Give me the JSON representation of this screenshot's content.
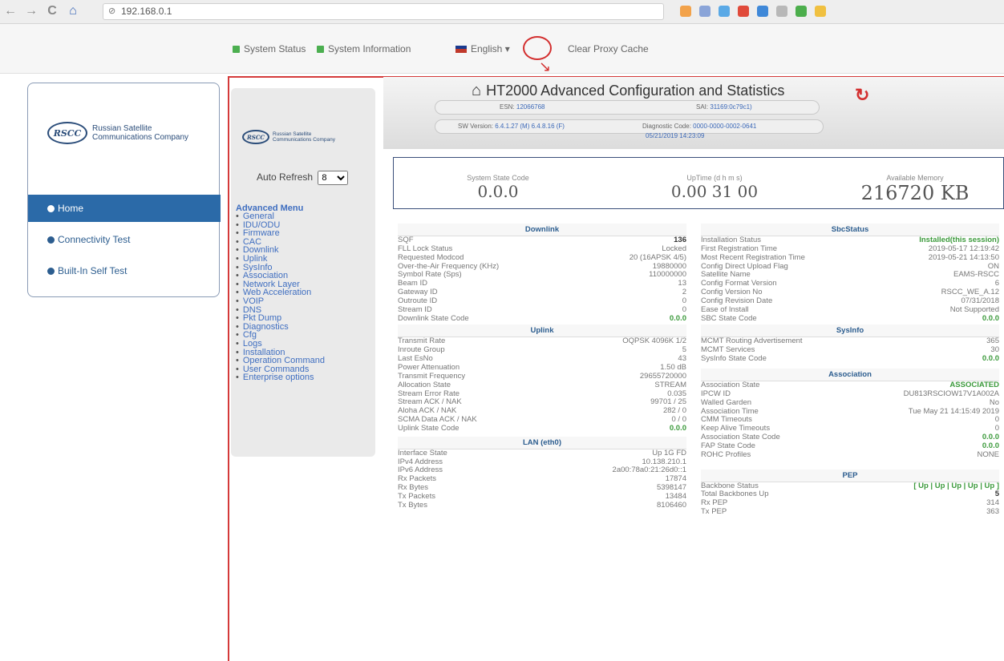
{
  "browser": {
    "url": "192.168.0.1",
    "back": "←",
    "forward": "→",
    "reload": "C",
    "home": "⌂",
    "secure": "⊘"
  },
  "topnav": {
    "system_status": "System Status",
    "system_information": "System Information",
    "language": "English ▾",
    "clear_proxy": "Clear Proxy Cache"
  },
  "logo": {
    "mark": "RSCC",
    "line1": "Russian Satellite",
    "line2": "Communications Company"
  },
  "leftnav": [
    {
      "label": "Home",
      "active": true
    },
    {
      "label": "Connectivity Test",
      "active": false
    },
    {
      "label": "Built-In Self Test",
      "active": false
    }
  ],
  "adv": {
    "auto_refresh_label": "Auto Refresh",
    "auto_refresh_value": "8",
    "menu_title": "Advanced Menu",
    "items": [
      "General",
      "IDU/ODU",
      "Firmware",
      "CAC",
      "Downlink",
      "Uplink",
      "SysInfo",
      "Association",
      "Network Layer",
      "Web Acceleration",
      "VOIP",
      "DNS",
      "Pkt Dump",
      "Diagnostics",
      "Cfg",
      "Logs",
      "Installation",
      "Operation Command",
      "User Commands",
      "Enterprise options"
    ]
  },
  "header": {
    "home_icon": "⌂",
    "title": "HT2000 Advanced Configuration and Statistics",
    "refresh_icon": "↻",
    "esn_label": "ESN:",
    "esn_value": "12066768",
    "san_label": "SAI:",
    "san_value": "31169:0c79c1)",
    "sw_label": "SW Version:",
    "sw_value": "6.4.1.27 (M) 6.4.8.16 (F)",
    "diag_label": "Diagnostic Code:",
    "diag_value": "0000-0000-0002-0641",
    "datetime": "05/21/2019 14:23:09"
  },
  "stats": {
    "state_label": "System State Code",
    "state_value": "0.0.0",
    "uptime_label": "UpTime (d h m s)",
    "uptime_value": "0.00 31 00",
    "memory_label": "Available Memory",
    "memory_value": "216720 KB"
  },
  "left_tables": [
    {
      "title": "Downlink",
      "rows": [
        [
          "SQF",
          "136",
          "b"
        ],
        [
          "FLL Lock Status",
          "Locked",
          ""
        ],
        [
          "Requested Modcod",
          "20 (16APSK 4/5)",
          ""
        ],
        [
          "Over-the-Air Frequency (KHz)",
          "19880000",
          ""
        ],
        [
          "Symbol Rate (Sps)",
          "110000000",
          ""
        ],
        [
          "Beam ID",
          "13",
          ""
        ],
        [
          "Gateway ID",
          "2",
          ""
        ],
        [
          "Outroute ID",
          "0",
          ""
        ],
        [
          "Stream ID",
          "0",
          ""
        ],
        [
          "Downlink State Code",
          "0.0.0",
          "g"
        ]
      ]
    },
    {
      "title": "Uplink",
      "rows": [
        [
          "Transmit Rate",
          "OQPSK 4096K 1/2",
          ""
        ],
        [
          "Inroute Group",
          "5",
          ""
        ],
        [
          "Last EsNo",
          "43",
          ""
        ],
        [
          "Power Attenuation",
          "1.50 dB",
          ""
        ],
        [
          "Transmit Frequency",
          "29655720000",
          ""
        ],
        [
          "Allocation State",
          "STREAM",
          ""
        ],
        [
          "Stream Error Rate",
          "0.035",
          ""
        ],
        [
          "Stream ACK / NAK",
          "99701 / 25",
          ""
        ],
        [
          "Aloha ACK / NAK",
          "282 / 0",
          ""
        ],
        [
          "SCMA Data ACK / NAK",
          "0 / 0",
          ""
        ],
        [
          "Uplink State Code",
          "0.0.0",
          "g"
        ]
      ]
    },
    {
      "title": "LAN (eth0)",
      "rows": [
        [
          "Interface State",
          "Up 1G FD",
          ""
        ],
        [
          "IPv4 Address",
          "10.138.210.1",
          ""
        ],
        [
          "IPv6 Address",
          "2a00:78a0:21:26d0::1",
          ""
        ],
        [
          "Rx Packets",
          "17874",
          ""
        ],
        [
          "Rx Bytes",
          "5398147",
          ""
        ],
        [
          "Tx Packets",
          "13484",
          ""
        ],
        [
          "Tx Bytes",
          "8106460",
          ""
        ]
      ]
    }
  ],
  "right_tables": [
    {
      "title": "SbcStatus",
      "rows": [
        [
          "Installation Status",
          "Installed(this session)",
          "gs"
        ],
        [
          "First Registration Time",
          "2019-05-17 12:19:42",
          ""
        ],
        [
          "Most Recent Registration Time",
          "2019-05-21 14:13:50",
          ""
        ],
        [
          "Config Direct Upload Flag",
          "ON",
          ""
        ],
        [
          "Satellite Name",
          "EAMS-RSCC",
          ""
        ],
        [
          "Config Format Version",
          "6",
          ""
        ],
        [
          "Config Version No",
          "RSCC_WE_A.12",
          ""
        ],
        [
          "Config Revision Date",
          "07/31/2018",
          ""
        ],
        [
          "Ease of Install",
          "Not Supported",
          ""
        ],
        [
          "SBC State Code",
          "0.0.0",
          "g"
        ]
      ]
    },
    {
      "title": "SysInfo",
      "rows": [
        [
          "MCMT Routing Advertisement",
          "365",
          ""
        ],
        [
          "MCMT Services",
          "30",
          ""
        ],
        [
          "SysInfo State Code",
          "0.0.0",
          "g"
        ]
      ]
    },
    {
      "title": "Association",
      "rows": [
        [
          "Association State",
          "ASSOCIATED",
          "gs"
        ],
        [
          "IPCW ID",
          "DU813RSCIOW17V1A002A",
          ""
        ],
        [
          "Walled Garden",
          "No",
          ""
        ],
        [
          "Association Time",
          "Tue May 21 14:15:49 2019",
          ""
        ],
        [
          "CMM Timeouts",
          "0",
          ""
        ],
        [
          "Keep Alive Timeouts",
          "0",
          ""
        ],
        [
          "Association State Code",
          "0.0.0",
          "g"
        ],
        [
          "FAP State Code",
          "0.0.0",
          "g"
        ],
        [
          "ROHC Profiles",
          "NONE",
          ""
        ]
      ]
    },
    {
      "title": "PEP",
      "rows": [
        [
          "Backbone Status",
          "[ Up | Up | Up | Up | Up ]",
          "gs"
        ],
        [
          "Total Backbones Up",
          "5",
          "b"
        ],
        [
          "Rx PEP",
          "314",
          ""
        ],
        [
          "Tx PEP",
          "363",
          ""
        ]
      ]
    }
  ],
  "colors": {
    "accent": "#2b6aa8",
    "annotation": "#d32f2f",
    "ok": "#3c9a3c",
    "link": "#3b68b8"
  }
}
